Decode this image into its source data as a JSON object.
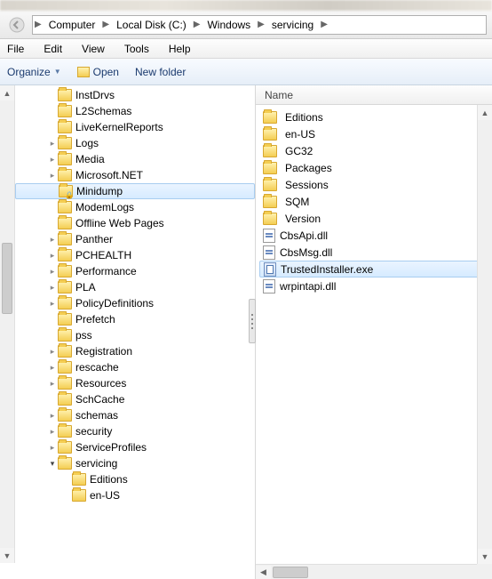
{
  "breadcrumb": [
    "Computer",
    "Local Disk (C:)",
    "Windows",
    "servicing"
  ],
  "menu": {
    "file": "File",
    "edit": "Edit",
    "view": "View",
    "tools": "Tools",
    "help": "Help"
  },
  "toolbar": {
    "organize": "Organize",
    "open": "Open",
    "newfolder": "New folder"
  },
  "list_header": {
    "name": "Name"
  },
  "tree": [
    {
      "indent": 2,
      "label": "InstDrvs",
      "exp": ""
    },
    {
      "indent": 2,
      "label": "L2Schemas",
      "exp": ""
    },
    {
      "indent": 2,
      "label": "LiveKernelReports",
      "exp": ""
    },
    {
      "indent": 2,
      "label": "Logs",
      "exp": ">"
    },
    {
      "indent": 2,
      "label": "Media",
      "exp": ">"
    },
    {
      "indent": 2,
      "label": "Microsoft.NET",
      "exp": ">"
    },
    {
      "indent": 2,
      "label": "Minidump",
      "exp": "",
      "locked": true,
      "sel": true
    },
    {
      "indent": 2,
      "label": "ModemLogs",
      "exp": ""
    },
    {
      "indent": 2,
      "label": "Offline Web Pages",
      "exp": ""
    },
    {
      "indent": 2,
      "label": "Panther",
      "exp": ">"
    },
    {
      "indent": 2,
      "label": "PCHEALTH",
      "exp": ">"
    },
    {
      "indent": 2,
      "label": "Performance",
      "exp": ">"
    },
    {
      "indent": 2,
      "label": "PLA",
      "exp": ">"
    },
    {
      "indent": 2,
      "label": "PolicyDefinitions",
      "exp": ">"
    },
    {
      "indent": 2,
      "label": "Prefetch",
      "exp": ""
    },
    {
      "indent": 2,
      "label": "pss",
      "exp": ""
    },
    {
      "indent": 2,
      "label": "Registration",
      "exp": ">"
    },
    {
      "indent": 2,
      "label": "rescache",
      "exp": ">"
    },
    {
      "indent": 2,
      "label": "Resources",
      "exp": ">"
    },
    {
      "indent": 2,
      "label": "SchCache",
      "exp": ""
    },
    {
      "indent": 2,
      "label": "schemas",
      "exp": ">"
    },
    {
      "indent": 2,
      "label": "security",
      "exp": ">"
    },
    {
      "indent": 2,
      "label": "ServiceProfiles",
      "exp": ">"
    },
    {
      "indent": 2,
      "label": "servicing",
      "exp": "v"
    },
    {
      "indent": 3,
      "label": "Editions",
      "exp": ""
    },
    {
      "indent": 3,
      "label": "en-US",
      "exp": ""
    }
  ],
  "list": [
    {
      "type": "folder",
      "name": "Editions"
    },
    {
      "type": "folder",
      "name": "en-US"
    },
    {
      "type": "folder",
      "name": "GC32"
    },
    {
      "type": "folder",
      "name": "Packages"
    },
    {
      "type": "folder",
      "name": "Sessions"
    },
    {
      "type": "folder",
      "name": "SQM"
    },
    {
      "type": "folder",
      "name": "Version"
    },
    {
      "type": "dll",
      "name": "CbsApi.dll"
    },
    {
      "type": "dll",
      "name": "CbsMsg.dll"
    },
    {
      "type": "exe",
      "name": "TrustedInstaller.exe",
      "sel": true
    },
    {
      "type": "dll",
      "name": "wrpintapi.dll"
    }
  ]
}
